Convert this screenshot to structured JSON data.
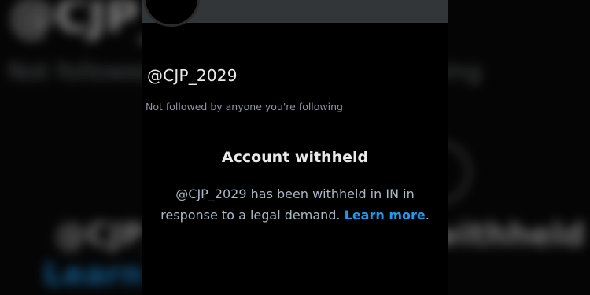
{
  "profile": {
    "handle": "@CJP_2029",
    "follow_note": "Not followed by anyone you're following"
  },
  "withheld": {
    "title": "Account withheld",
    "message": "@CJP_2029 has been withheld in IN in response to a legal demand.",
    "link_label": "Learn more",
    "link_suffix": "."
  },
  "colors": {
    "background": "#000000",
    "banner": "#333639",
    "primary_text": "#e7e9ea",
    "secondary_text": "#8b98a5",
    "link": "#1d9bf0"
  }
}
